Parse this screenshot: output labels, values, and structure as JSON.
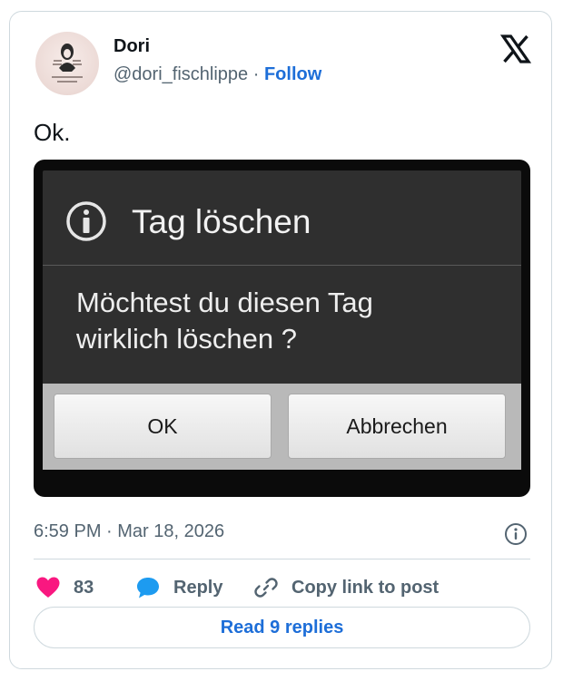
{
  "author": {
    "name": "Dori",
    "handle": "@dori_fischlippe",
    "separator": "·",
    "follow_label": "Follow"
  },
  "tweet": {
    "text": "Ok."
  },
  "media_dialog": {
    "title": "Tag löschen",
    "message": "Möchtest du diesen Tag\nwirklich löschen ?",
    "ok_label": "OK",
    "cancel_label": "Abbrechen"
  },
  "meta": {
    "timestamp": "6:59 PM · Mar 18, 2026"
  },
  "actions": {
    "like_count": "83",
    "reply_label": "Reply",
    "copy_link_label": "Copy link to post"
  },
  "footer": {
    "read_replies_label": "Read 9 replies"
  },
  "colors": {
    "accent": "#1d6ed8",
    "like": "#f91880",
    "reply_icon": "#1d9bf0",
    "muted": "#536471",
    "dialog_bg": "#2f2f2f"
  },
  "icons": {
    "brand": "x-logo-icon",
    "info": "info-circle-icon",
    "like": "heart-icon",
    "reply": "speech-bubble-icon",
    "copy_link": "link-icon"
  }
}
